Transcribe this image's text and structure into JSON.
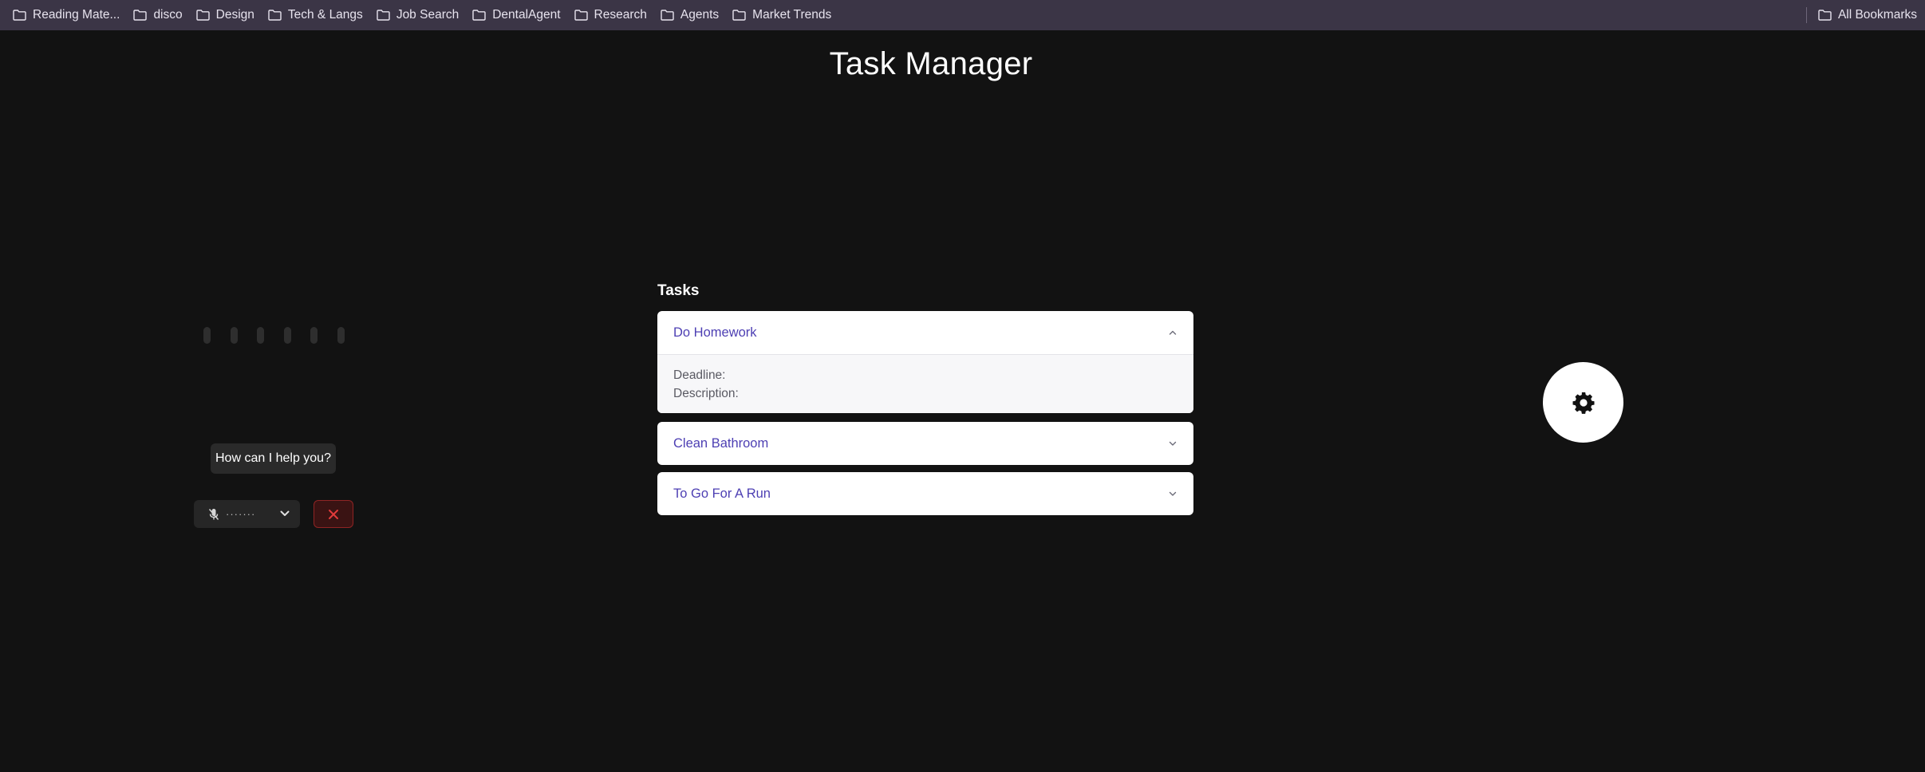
{
  "bookmarks": {
    "items": [
      {
        "label": "Reading Mate...",
        "icon": "folder-icon"
      },
      {
        "label": "disco",
        "icon": "folder-icon"
      },
      {
        "label": "Design",
        "icon": "folder-icon"
      },
      {
        "label": "Tech & Langs",
        "icon": "folder-icon"
      },
      {
        "label": "Job Search",
        "icon": "folder-icon"
      },
      {
        "label": "DentalAgent",
        "icon": "folder-icon"
      },
      {
        "label": "Research",
        "icon": "folder-icon"
      },
      {
        "label": "Agents",
        "icon": "folder-icon"
      },
      {
        "label": "Market Trends",
        "icon": "folder-icon"
      }
    ],
    "all_bookmarks_label": "All Bookmarks"
  },
  "app": {
    "title": "Task Manager"
  },
  "assistant": {
    "prompt": "How can I help you?",
    "mic_label": "·······",
    "mic_icon": "mic-off-icon",
    "close_icon": "close-icon",
    "wave_bars": 6
  },
  "tasks": {
    "heading": "Tasks",
    "items": [
      {
        "title": "Do Homework",
        "expanded": true,
        "deadline_label": "Deadline:",
        "description_label": "Description:"
      },
      {
        "title": "Clean Bathroom",
        "expanded": false
      },
      {
        "title": "To Go For A Run",
        "expanded": false
      }
    ]
  },
  "settings": {
    "icon": "gear-icon"
  },
  "colors": {
    "background": "#121212",
    "bookmarks_bar": "#3b3546",
    "task_title": "#4d3fb3",
    "close_border": "#8f2424",
    "close_icon": "#e23b3b"
  }
}
